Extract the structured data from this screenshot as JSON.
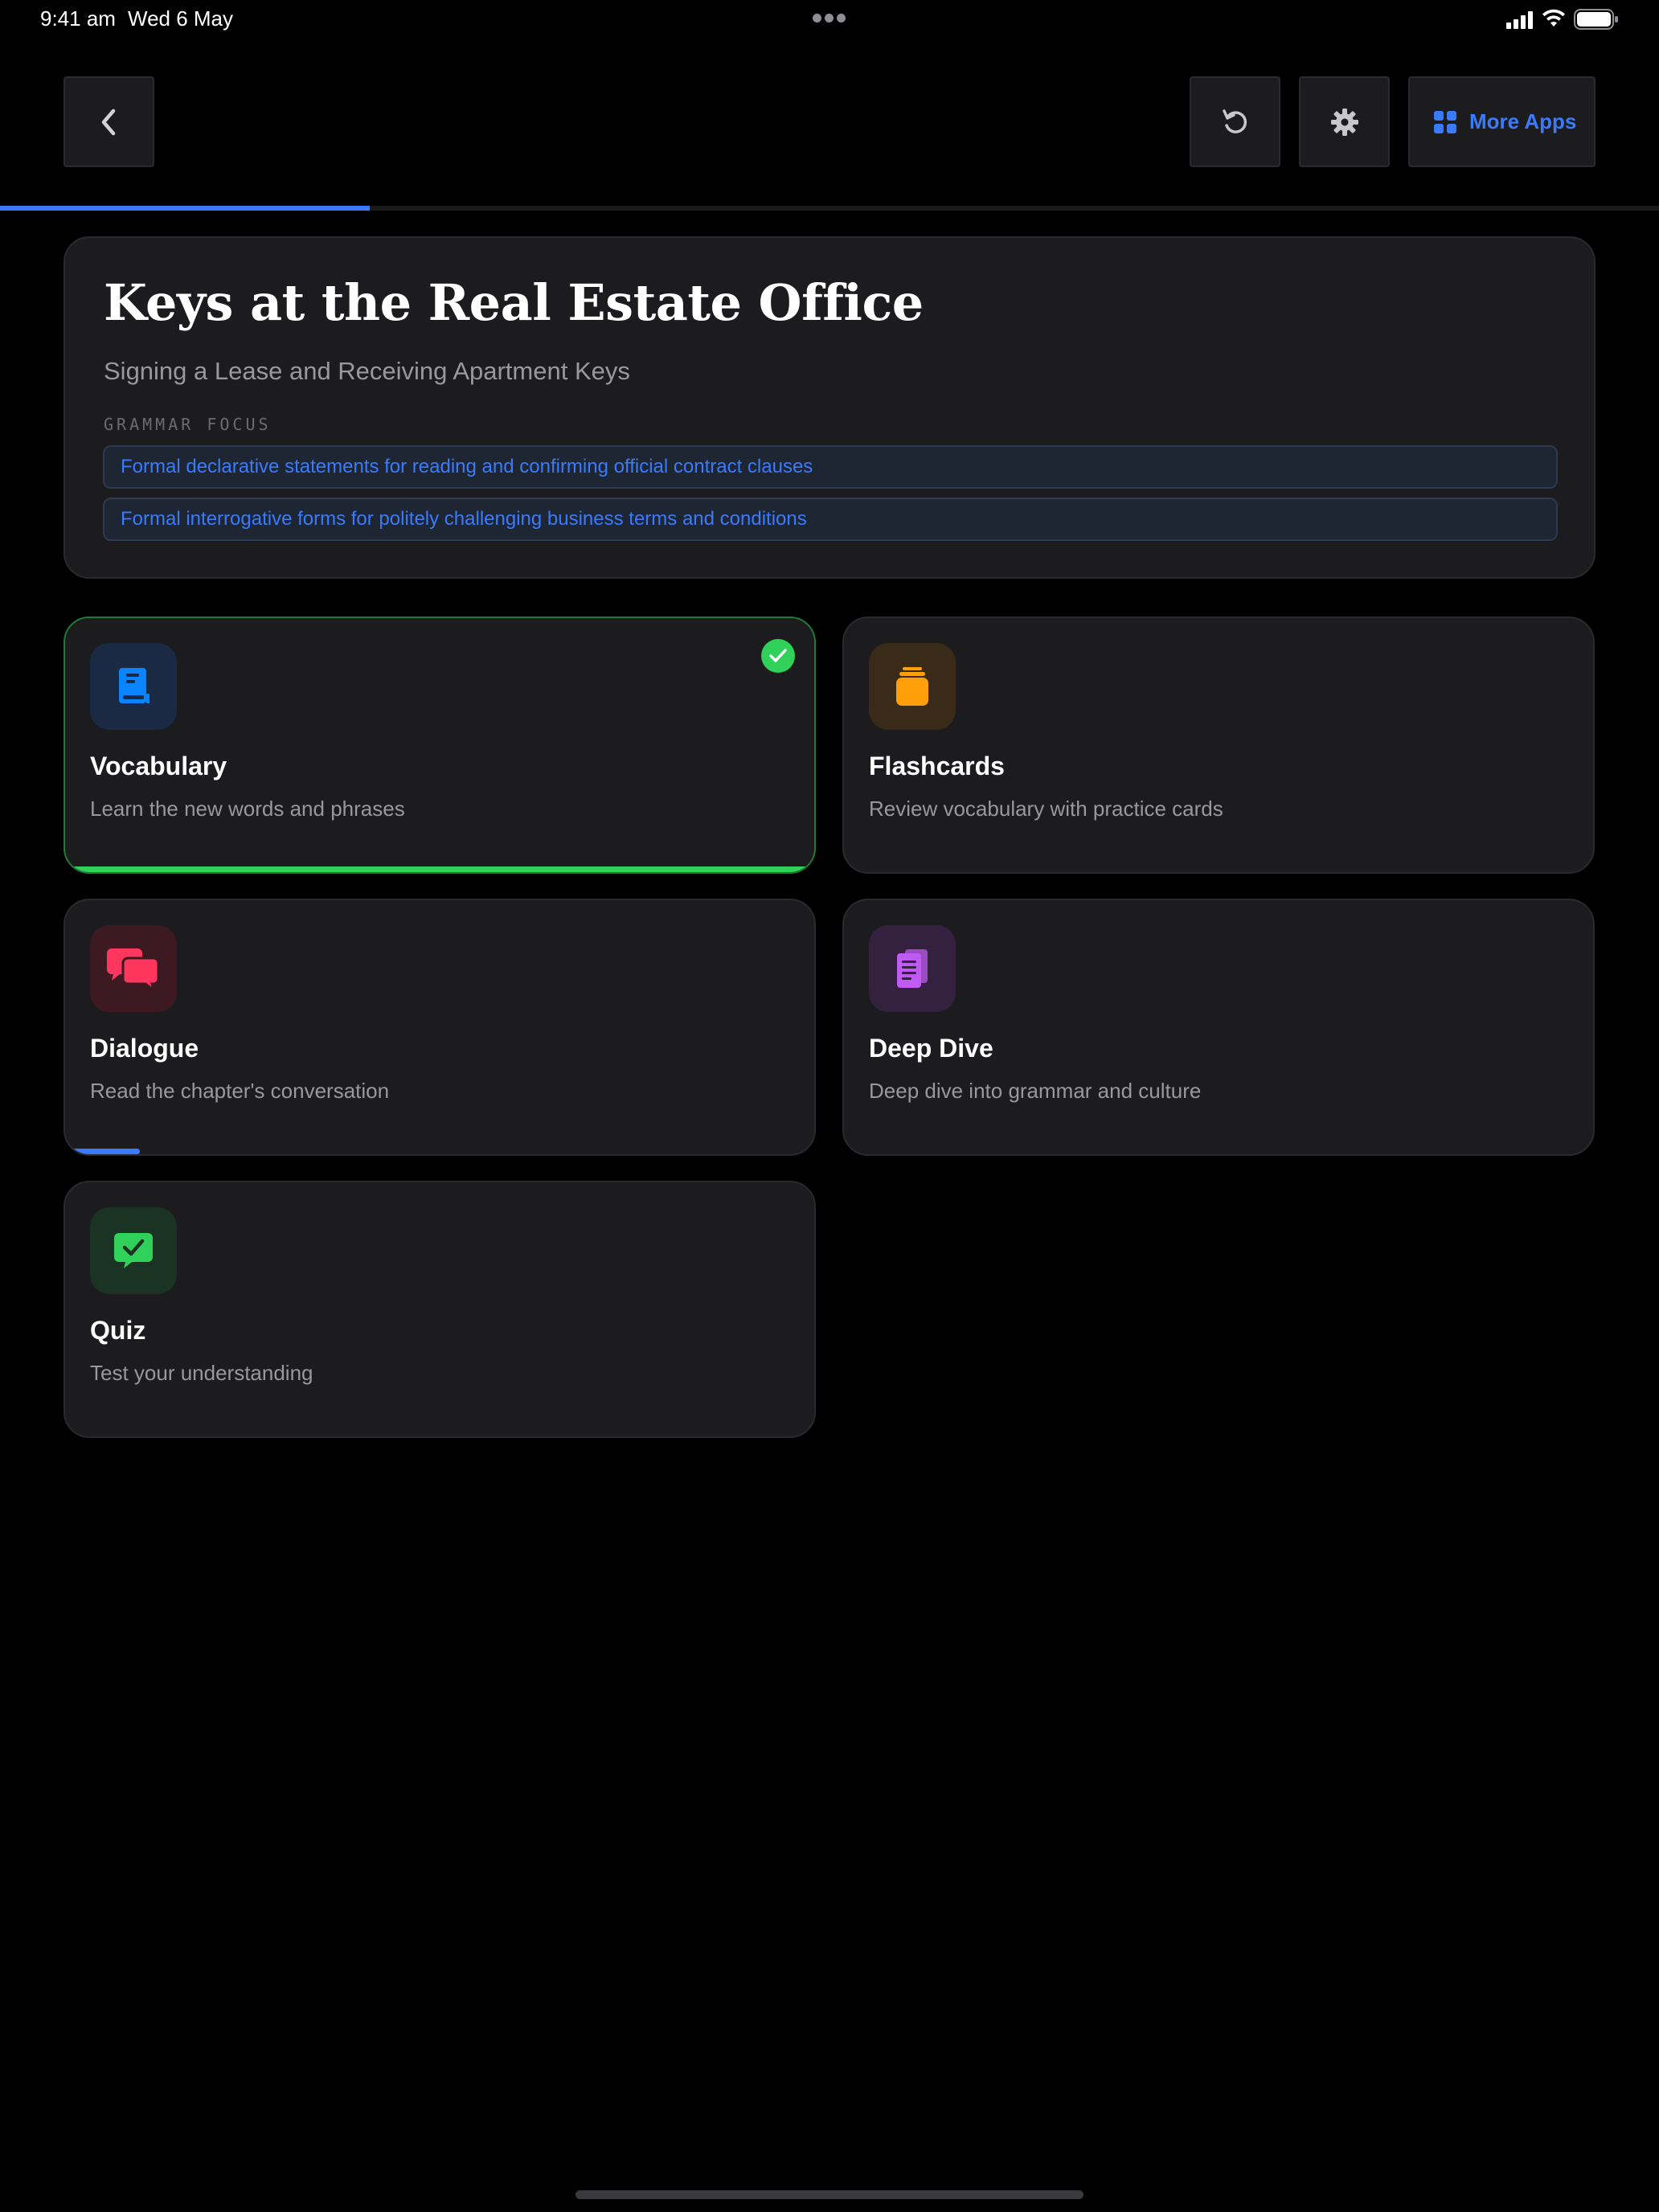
{
  "status_bar": {
    "time": "9:41 am",
    "date": "Wed 6 May"
  },
  "toolbar": {
    "back_icon": "chevron-left-icon",
    "reset_icon": "reset-icon",
    "settings_icon": "gear-icon",
    "more_apps_label": "More Apps",
    "more_apps_icon": "grid-icon",
    "accent_color": "#3a7bfd"
  },
  "progress": {
    "chapter_fraction": 0.223
  },
  "chapter": {
    "title": "Keys at the Real Estate Office",
    "subtitle": "Signing a Lease and Receiving Apartment Keys",
    "grammar_label": "GRAMMAR FOCUS",
    "grammar_points": [
      "Formal declarative statements for reading and confirming official contract clauses",
      "Formal interrogative forms for politely challenging business terms and conditions"
    ]
  },
  "modules": [
    {
      "title": "Vocabulary",
      "description": "Learn the new words and phrases",
      "icon": "book-icon",
      "color": "#0a84ff",
      "completed": true,
      "progress": 1.0,
      "progress_color": "#30d158"
    },
    {
      "title": "Flashcards",
      "description": "Review vocabulary with practice cards",
      "icon": "card-stack-icon",
      "color": "#ff9f0a",
      "completed": false,
      "progress": 0
    },
    {
      "title": "Dialogue",
      "description": "Read the chapter's conversation",
      "icon": "chat-bubbles-icon",
      "color": "#ff375f",
      "completed": false,
      "progress": 0.1,
      "progress_color": "#3a7bfd"
    },
    {
      "title": "Deep Dive",
      "description": "Deep dive into grammar and culture",
      "icon": "document-icon",
      "color": "#bf5af2",
      "completed": false,
      "progress": 0
    },
    {
      "title": "Quiz",
      "description": "Test your understanding",
      "icon": "quiz-check-icon",
      "color": "#30d158",
      "completed": false,
      "progress": 0
    }
  ]
}
